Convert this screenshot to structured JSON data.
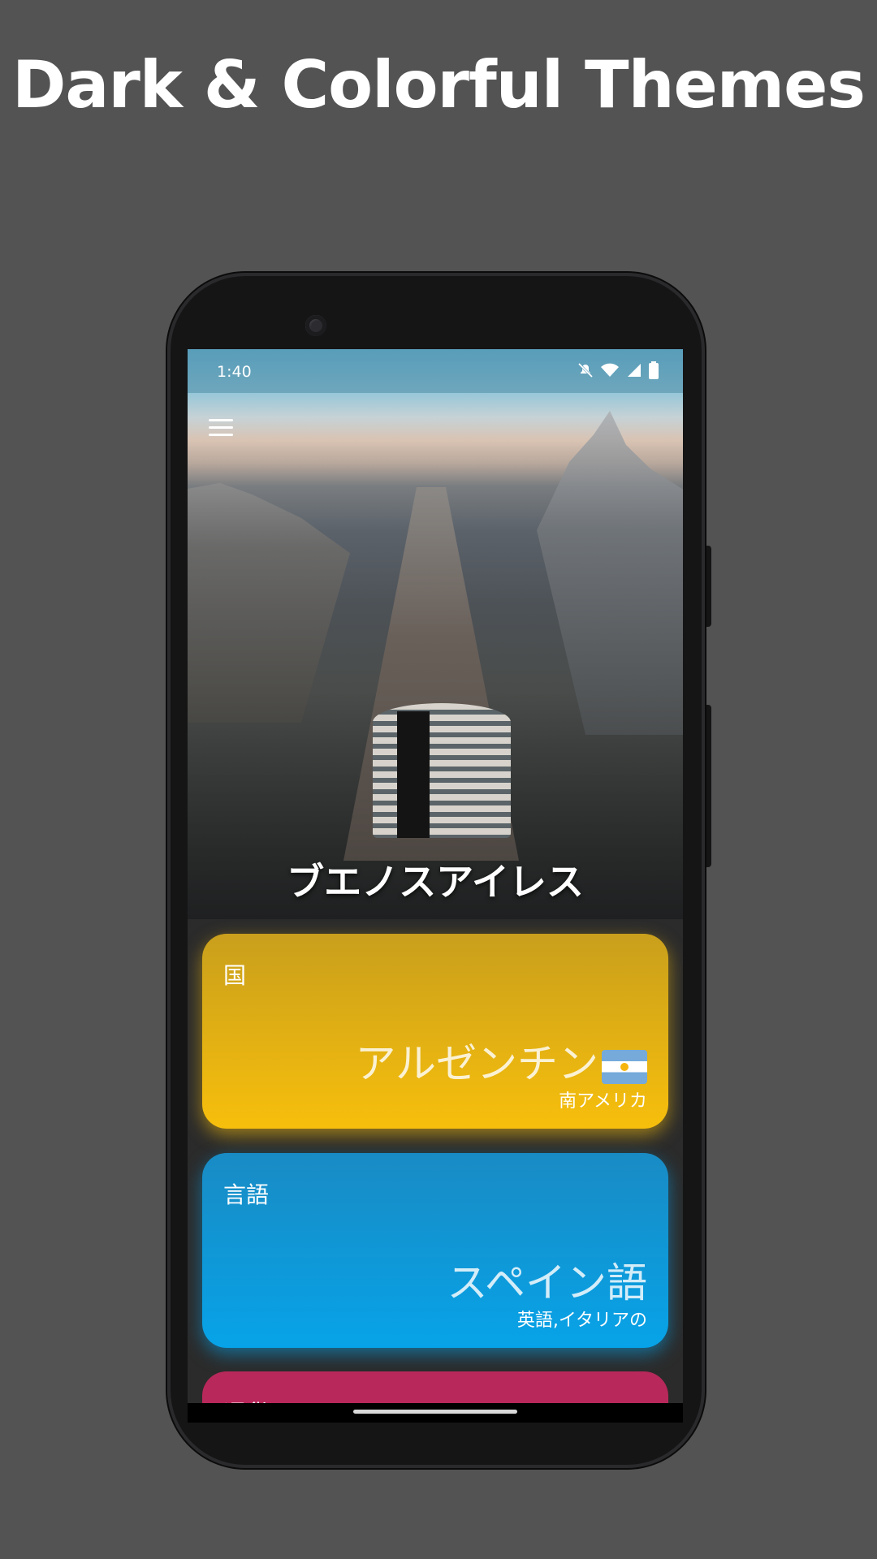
{
  "headline": "Dark & Colorful Themes",
  "status_bar": {
    "time": "1:40",
    "icons": [
      "bell-off-icon",
      "wifi-icon",
      "signal-icon",
      "battery-icon"
    ]
  },
  "hero": {
    "city_name": "ブエノスアイレス",
    "menu_icon": "hamburger-menu-icon"
  },
  "cards": {
    "country": {
      "label": "国",
      "value": "アルゼンチン",
      "subtext": "南アメリカ",
      "flag": "argentina-flag-icon",
      "color": "#f7bf0c"
    },
    "language": {
      "label": "言語",
      "value": "スペイン語",
      "subtext": "英語,イタリアの",
      "color": "#07a3e8"
    },
    "currency": {
      "label": "通貨",
      "color": "#b8285a"
    }
  }
}
